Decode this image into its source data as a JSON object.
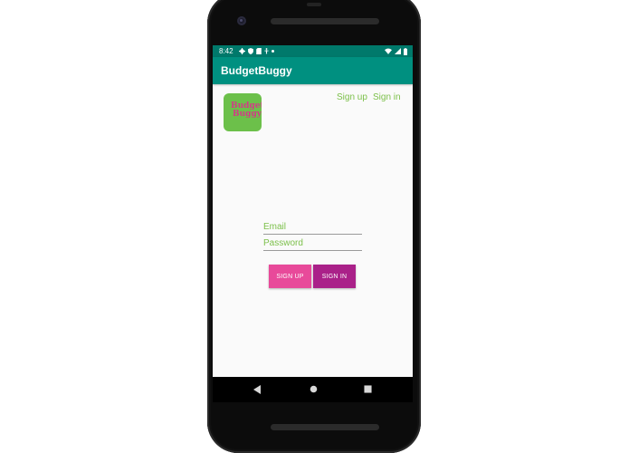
{
  "status_bar": {
    "time": "8:42",
    "left_icons": [
      "gear-icon",
      "shield-icon",
      "sd-card-icon",
      "accessibility-icon",
      "dot-icon"
    ],
    "right_icons": [
      "wifi-icon",
      "cell-signal-icon",
      "battery-icon"
    ]
  },
  "app_bar": {
    "title": "BudgetBuggy"
  },
  "logo": {
    "line1": "Budget",
    "line2": "Buggy"
  },
  "links": {
    "signup": "Sign up",
    "signin": "Sign in"
  },
  "form": {
    "email_placeholder": "Email",
    "password_placeholder": "Password",
    "signup_label": "SIGN UP",
    "signin_label": "SIGN IN"
  },
  "nav": [
    "back-icon",
    "home-icon",
    "recents-icon"
  ],
  "colors": {
    "status_bar": "#00796b",
    "app_bar": "#009080",
    "accent_green": "#7cc04a",
    "signup_button": "#e84a9a",
    "signin_button": "#aa2189",
    "logo_bg": "#6cc04a",
    "logo_text": "#d13c86"
  }
}
